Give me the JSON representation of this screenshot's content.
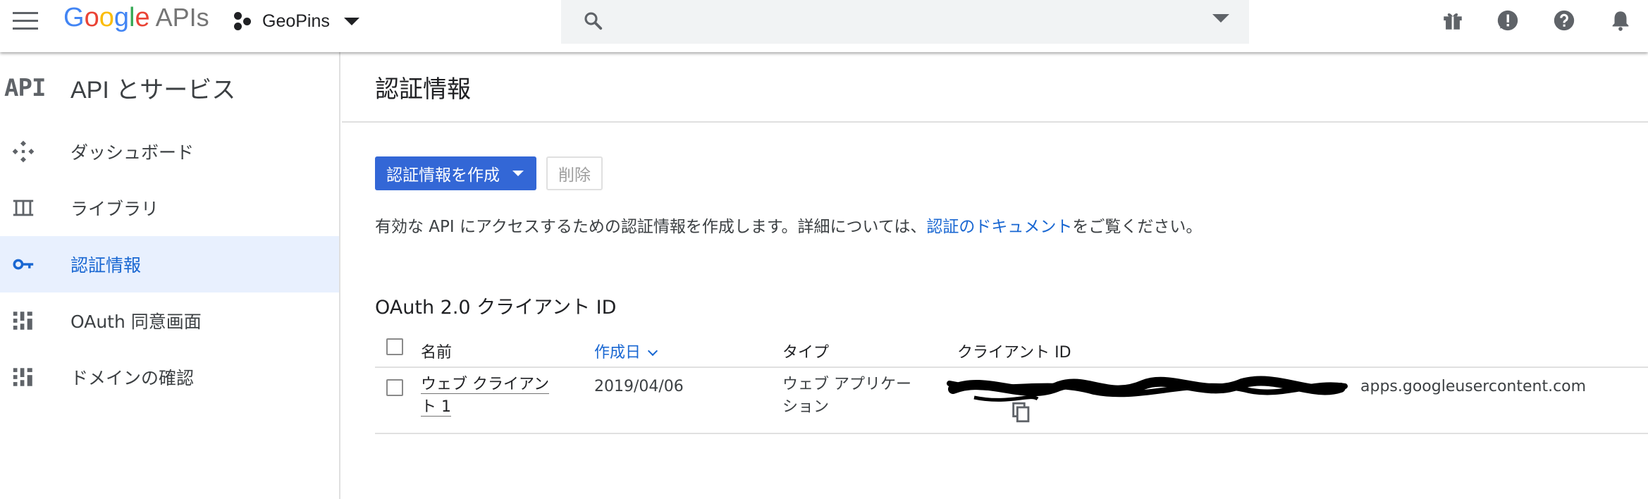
{
  "topbar": {
    "logo_google_letters": [
      "G",
      "o",
      "o",
      "g",
      "l",
      "e"
    ],
    "logo_suffix": "APIs",
    "project_name": "GeoPins",
    "search_placeholder": "",
    "icons": [
      "gift-icon",
      "feedback-icon",
      "help-icon",
      "notifications-icon"
    ]
  },
  "sidebar": {
    "logo_text": "API",
    "title": "API とサービス",
    "items": [
      {
        "label": "ダッシュボード",
        "icon": "dashboard-icon",
        "active": false
      },
      {
        "label": "ライブラリ",
        "icon": "library-icon",
        "active": false
      },
      {
        "label": "認証情報",
        "icon": "key-icon",
        "active": true
      },
      {
        "label": "OAuth 同意画面",
        "icon": "consent-screen-icon",
        "active": false
      },
      {
        "label": "ドメインの確認",
        "icon": "domain-verification-icon",
        "active": false
      }
    ]
  },
  "main": {
    "title": "認証情報",
    "create_button_label": "認証情報を作成",
    "delete_button_label": "削除",
    "description_prefix": "有効な API にアクセスするための認証情報を作成します。詳細については、",
    "description_link": "認証のドキュメント",
    "description_suffix": "をご覧ください。",
    "section_title": "OAuth 2.0 クライアント ID",
    "table": {
      "headers": {
        "name": "名前",
        "created": "作成日",
        "type": "タイプ",
        "client_id": "クライアント ID"
      },
      "rows": [
        {
          "name_line1": "ウェブ クライアン",
          "name_line2": "ト 1",
          "created": "2019/04/06",
          "type_line1": "ウェブ アプリケー",
          "type_line2": "ション",
          "client_id_visible_part": "apps.googleusercontent.com"
        }
      ]
    }
  },
  "colors": {
    "accent": "#3367d6",
    "link": "#1967d2",
    "active_nav_bg": "#e8f0fe"
  }
}
